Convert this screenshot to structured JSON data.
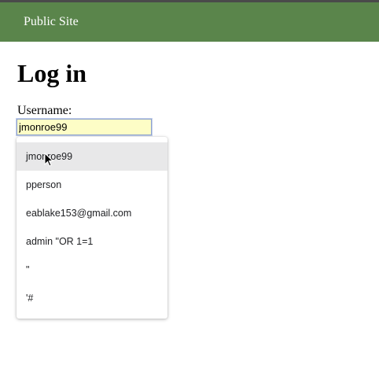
{
  "navbar": {
    "brand": "Public Site"
  },
  "page": {
    "title": "Log in"
  },
  "form": {
    "username_label": "Username:",
    "username_value": "jmonroe99"
  },
  "autocomplete": {
    "hovered_index": 0,
    "items": [
      {
        "label": "jmonroe99"
      },
      {
        "label": "pperson"
      },
      {
        "label": "eablake153@gmail.com"
      },
      {
        "label": "admin \"OR 1=1"
      },
      {
        "label": "\""
      },
      {
        "label": "'#"
      }
    ]
  },
  "icons": {
    "cursor": "mouse-pointer-icon"
  },
  "colors": {
    "navbar": "#5a854b",
    "input_autofill_bg": "#fdfdc6",
    "hover_bg": "#e8e8e9"
  }
}
